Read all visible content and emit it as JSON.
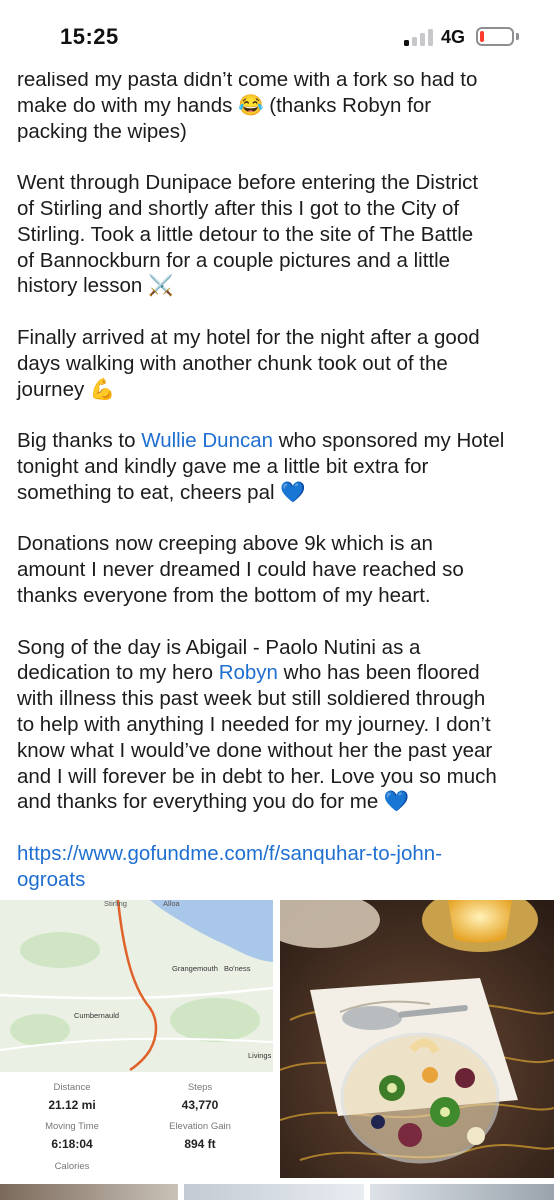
{
  "status_bar": {
    "time": "15:25",
    "network": "4G",
    "signal_bars_active": 1,
    "signal_bars_total": 4,
    "battery_level": 0.1
  },
  "post": {
    "lines_p1": [
      "realised my pasta didn’t come with a fork so had to",
      "make do with my hands 😂 (thanks Robyn for",
      "packing the wipes)"
    ],
    "lines_p2": [
      "Went through Dunipace before entering the District",
      "of Stirling and shortly after this I got to the City of",
      "Stirling.  Took a little detour to the site of The Battle",
      "of Bannockburn for a couple pictures and a little",
      "history lesson ⚔️"
    ],
    "lines_p3": [
      "Finally arrived at my hotel for the night after a good",
      "days walking with another chunk took out of the",
      "journey 💪"
    ],
    "p4": {
      "pre": "Big thanks to ",
      "mention": "Wullie Duncan",
      "post": " who sponsored my Hotel",
      "line2": "tonight and kindly gave me a little bit extra for",
      "line3": "something to eat, cheers pal 💙"
    },
    "lines_p5": [
      "Donations now creeping above 9k which is an",
      "amount I never dreamed I could have reached so",
      "thanks everyone from the bottom of my heart."
    ],
    "p6": {
      "line1": "Song of the day is Abigail - Paolo Nutini as a",
      "line2_pre": "dedication to my hero ",
      "mention": "Robyn",
      "line2_post": " who has been floored",
      "line3": "with illness this past week but still soldiered through",
      "line4": "to help with anything I needed for my journey.  I don’t",
      "line5": "know what I would’ve done without her the past year",
      "line6": "and I will forever be in debt to her. Love you so much",
      "line7": "and thanks for everything you do for me 💙"
    },
    "link_line1": "https://www.gofundme.com/f/sanquhar-to-john-",
    "link_line2": "ogroats"
  },
  "map": {
    "labels": {
      "top": "Stirling",
      "alloa": "Alloa",
      "grangemouth": "Grangemouth",
      "boness": "Bo'ness",
      "cumbernauld": "Cumbernauld",
      "livingston": "Livings"
    },
    "route_color": "#e0622b",
    "water_color": "#a9c7e8",
    "land_color": "#eaf0e4",
    "park_color": "#cfe5c4"
  },
  "stats": {
    "distance_label": "Distance",
    "distance_value": "21.12 mi",
    "steps_label": "Steps",
    "steps_value": "43,770",
    "moving_time_label": "Moving Time",
    "moving_time_value": "6:18:04",
    "elevation_label": "Elevation Gain",
    "elevation_value": "894 ft",
    "calories_label": "Calories"
  },
  "colors": {
    "link": "#1f6fd0",
    "text": "#1c1c1e"
  }
}
